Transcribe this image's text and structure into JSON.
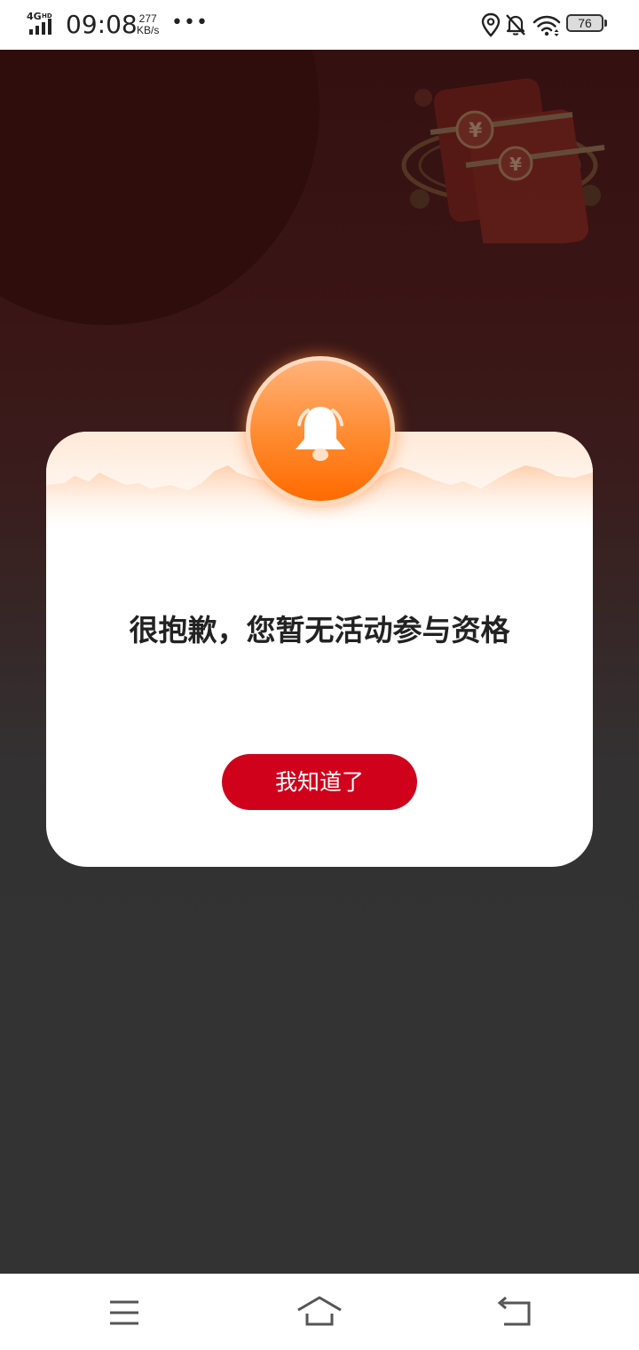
{
  "status_bar": {
    "network_label": "4G",
    "network_hd": "HD",
    "time": "09:08",
    "speed_value": "277",
    "speed_unit": "KB/s",
    "more_dots": "•••",
    "battery_level": "76",
    "icons": [
      "signal-icon",
      "location-icon",
      "bell-muted-icon",
      "wifi-icon",
      "battery-icon"
    ]
  },
  "dialog": {
    "icon": "bell-icon",
    "message": "很抱歉，您暂无活动参与资格",
    "button_label": "我知道了",
    "accent_color": "#d0021b"
  },
  "nav_bar": {
    "icons": [
      "menu-icon",
      "home-icon",
      "back-icon"
    ]
  },
  "colors": {
    "overlay_background": "#333333",
    "page_top": "#341010",
    "button": "#d0021b",
    "badge_orange": "#ff8a2e"
  }
}
